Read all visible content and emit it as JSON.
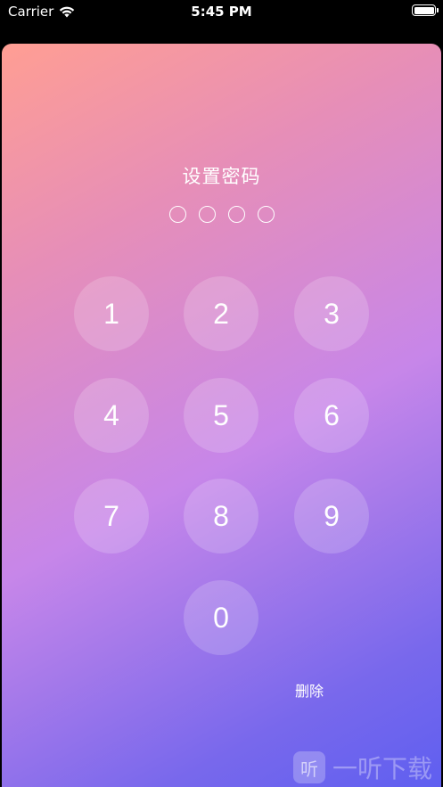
{
  "status_bar": {
    "carrier": "Carrier",
    "time": "5:45 PM",
    "wifi_icon": "wifi-icon",
    "battery_icon": "battery-icon"
  },
  "passcode": {
    "title": "设置密码",
    "dot_count": 4,
    "filled": 0
  },
  "keypad": {
    "keys": [
      "1",
      "2",
      "3",
      "4",
      "5",
      "6",
      "7",
      "8",
      "9",
      "0"
    ],
    "delete_label": "删除"
  },
  "watermark": {
    "logo_text": "听",
    "text": "一听下载"
  },
  "colors": {
    "gradient_start": "#ff9e93",
    "gradient_mid": "#c786e9",
    "gradient_end": "#5f5ff0"
  }
}
